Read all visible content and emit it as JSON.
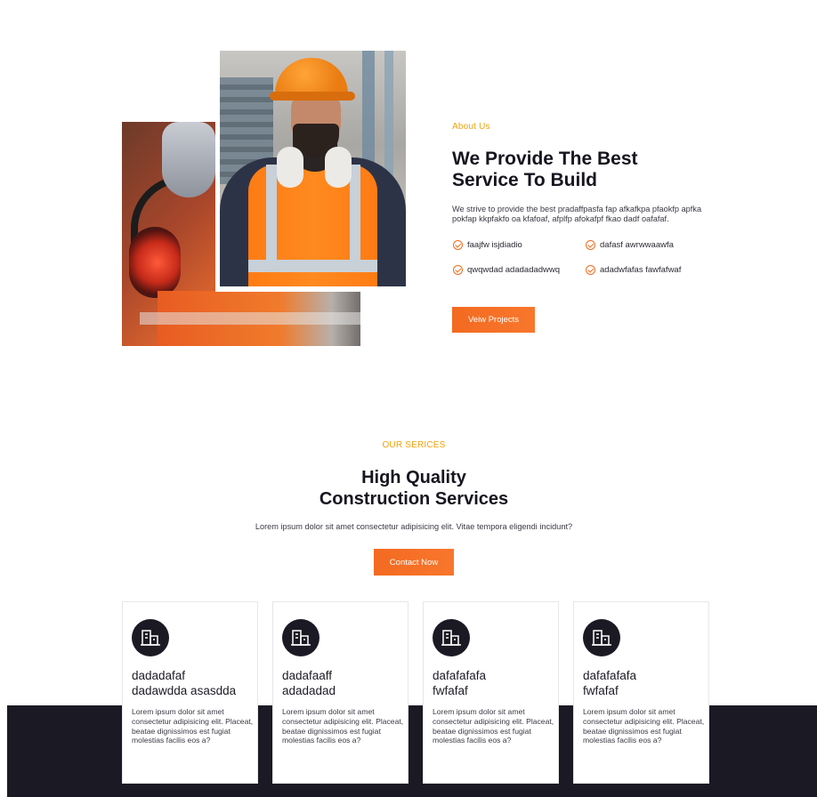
{
  "about": {
    "eyebrow": "About Us",
    "title_line1": "We Provide The Best",
    "title_line2": "Service To Build",
    "description": "We strive to provide the best pradaffpasfa fap afkafkpa pfaokfp apfka pokfap kkpfakfo oa kfafoaf, afplfp afokafpf fkao dadf oafafaf.",
    "features": [
      "faajfw isjdiadio",
      "dafasf awrwwaawfa",
      "qwqwdad adadadadwwq",
      "adadwfafas fawfafwaf"
    ],
    "button_label": "Veiw Projects"
  },
  "services": {
    "eyebrow": "OUR SERICES",
    "title_line1": "High Quality",
    "title_line2": "Construction Services",
    "description": "Lorem ipsum dolor sit amet consectetur adipisicing elit. Vitae tempora eligendi incidunt?",
    "button_label": "Contact Now",
    "cards": [
      {
        "icon": "building-icon",
        "title_line1": "dadadafaf",
        "title_line2": "dadawdda asasdda",
        "text": "Lorem ipsum dolor sit amet consectetur adipisicing elit. Placeat, beatae dignissimos est fugiat molestias facilis eos a?"
      },
      {
        "icon": "building-icon",
        "title_line1": "dadafaaff",
        "title_line2": "adadadad",
        "text": "Lorem ipsum dolor sit amet consectetur adipisicing elit. Placeat, beatae dignissimos est fugiat molestias facilis eos a?"
      },
      {
        "icon": "building-icon",
        "title_line1": "dafafafafa",
        "title_line2": "fwfafaf",
        "text": "Lorem ipsum dolor sit amet consectetur adipisicing elit. Placeat, beatae dignissimos est fugiat molestias facilis eos a?"
      },
      {
        "icon": "building-icon",
        "title_line1": "dafafafafa",
        "title_line2": "fwfafaf",
        "text": "Lorem ipsum dolor sit amet consectetur adipisicing elit. Placeat, beatae dignissimos est fugiat molestias facilis eos a?"
      }
    ]
  },
  "colors": {
    "accent": "#f36a21",
    "eyebrow": "#f2a20b",
    "dark": "#1b1a24"
  }
}
